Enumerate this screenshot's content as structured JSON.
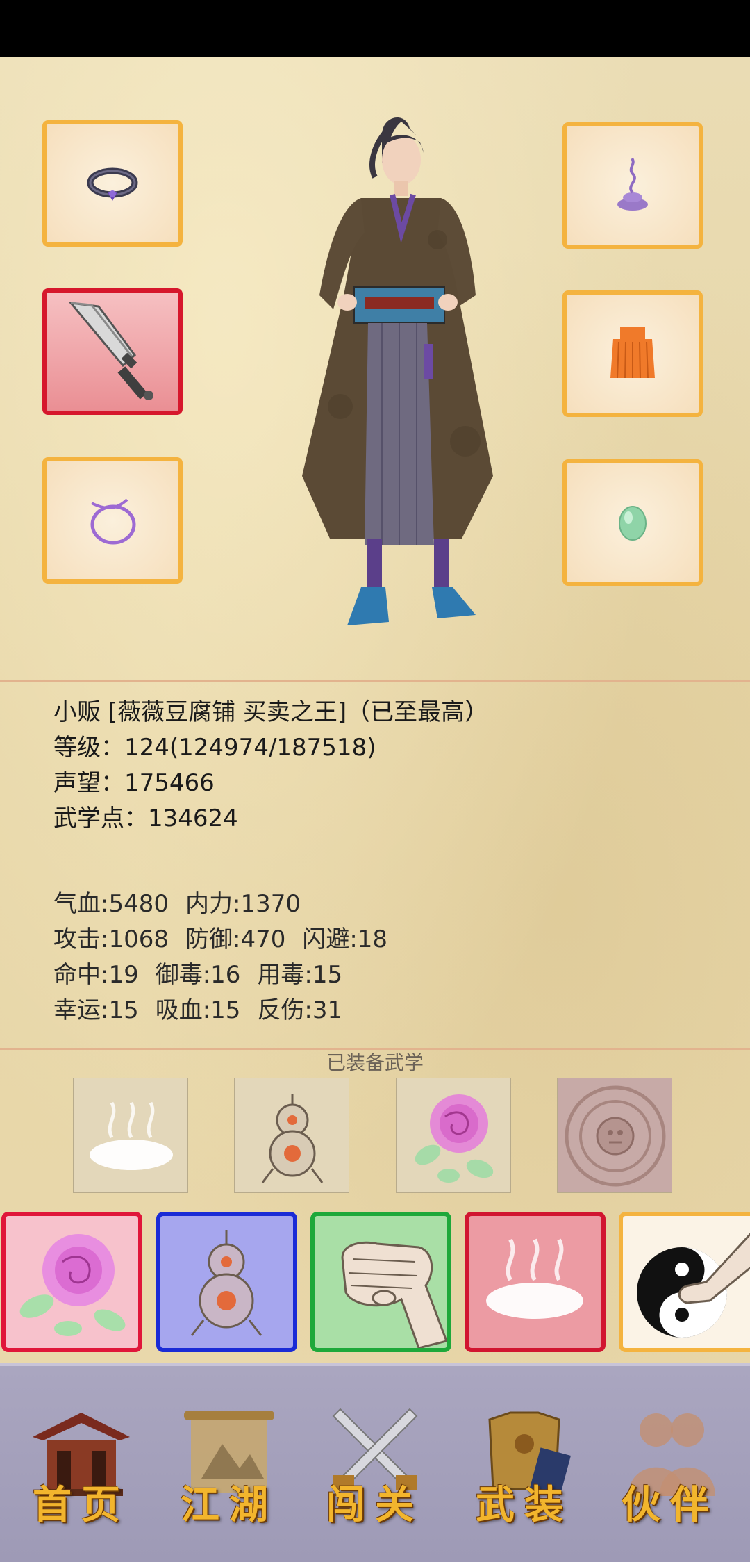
{
  "character": {
    "title_line": "小贩 [薇薇豆腐铺 买卖之王]（已至最高）",
    "level_line": "等级：124(124974/187518)",
    "prestige_line": "声望：175466",
    "martial_points_line": "武学点：134624"
  },
  "stats": {
    "row1": [
      "气血:5480",
      "内力:1370"
    ],
    "row2": [
      "攻击:1068",
      "防御:470",
      "闪避:18"
    ],
    "row3": [
      "命中:19",
      "御毒:16",
      "用毒:15"
    ],
    "row4": [
      "幸运:15",
      "吸血:15",
      "反伤:31"
    ]
  },
  "equipment_slots": [
    {
      "name": "ring-icon",
      "side": "left"
    },
    {
      "name": "broadsword-icon",
      "side": "left",
      "highlight": "#d6172c"
    },
    {
      "name": "bracelet-icon",
      "side": "left"
    },
    {
      "name": "incense-icon",
      "side": "right"
    },
    {
      "name": "armor-skirt-icon",
      "side": "right"
    },
    {
      "name": "jade-bead-icon",
      "side": "right"
    }
  ],
  "equipped_martial": {
    "label": "已装备武学",
    "slots": [
      "mist-icon",
      "gourd-icon",
      "rose-icon",
      "stone-seal-icon"
    ]
  },
  "skills": [
    {
      "name": "rose-icon",
      "border": "#e0163a"
    },
    {
      "name": "gourd-icon",
      "border": "#1a2bd6"
    },
    {
      "name": "fist-icon",
      "border": "#1ea83a"
    },
    {
      "name": "mist-icon",
      "border": "#d11530"
    },
    {
      "name": "taiji-palm-icon",
      "border": "#f4b33f"
    }
  ],
  "nav": {
    "home": "首页",
    "jianghu": "江湖",
    "challenge": "闯关",
    "equipment": "武装",
    "partners": "伙伴"
  },
  "colors": {
    "slot_border": "#f4b33f",
    "nav_label": "#f2b52d",
    "parchment": "#e9d9ad"
  }
}
